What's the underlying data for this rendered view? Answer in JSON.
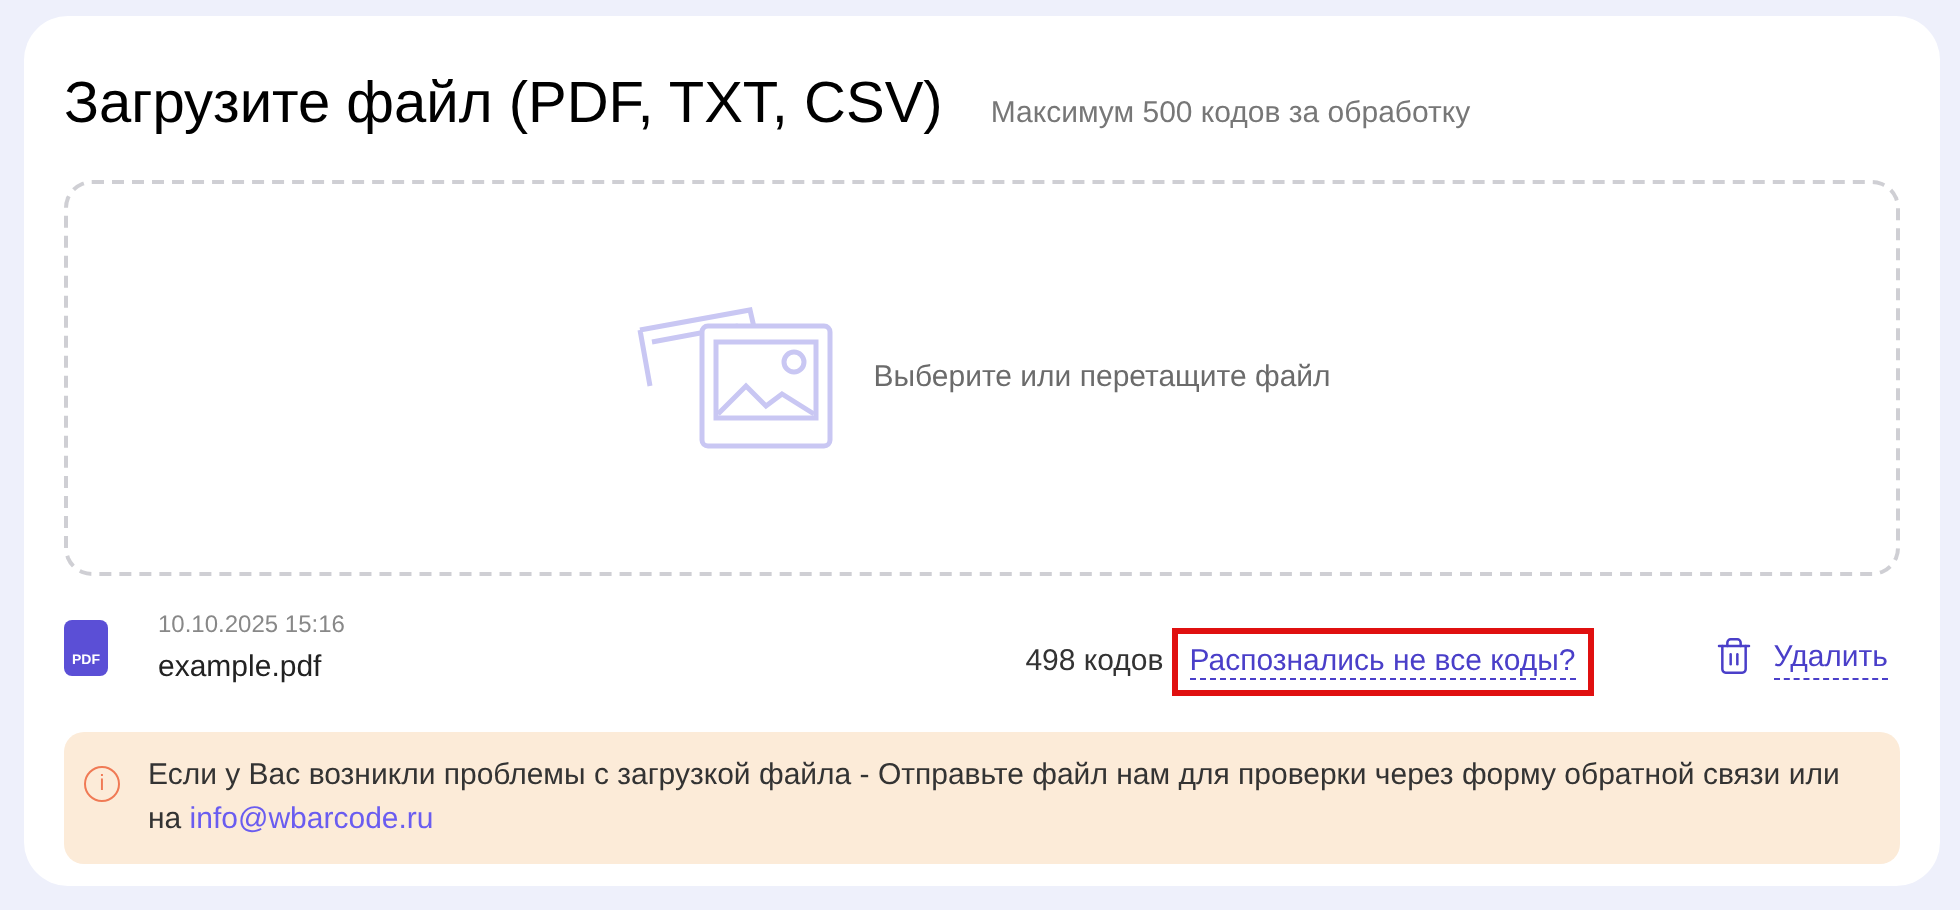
{
  "header": {
    "title": "Загрузите файл (PDF, TXT, CSV)",
    "subtitle": "Максимум 500 кодов за обработку"
  },
  "dropzone": {
    "prompt": "Выберите или перетащите файл"
  },
  "file": {
    "type_label": "PDF",
    "date": "10.10.2025 15:16",
    "name": "example.pdf",
    "count": "498 кодов",
    "recognize_link": {
      "label": "Распознались не все коды?",
      "highlighted": true
    },
    "delete_label": "Удалить"
  },
  "notice": {
    "icon": "i",
    "text": "Если у Вас возникли проблемы с загрузкой файла - Отправьте файл нам для проверки через форму обратной связи или на ",
    "email": "info@wbarcode.ru"
  }
}
